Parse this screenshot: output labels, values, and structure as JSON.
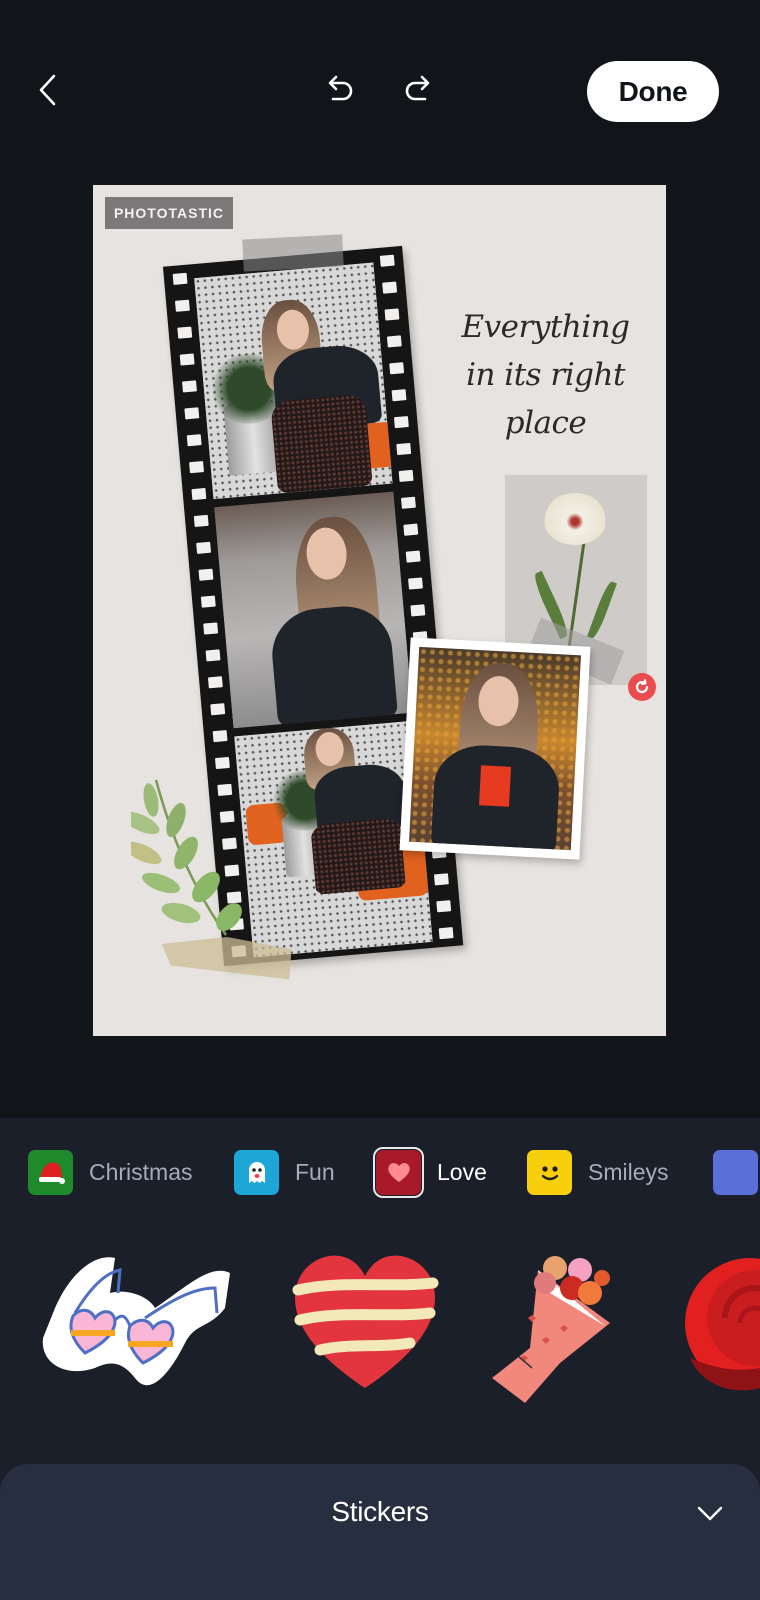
{
  "topbar": {
    "back_icon": "chevron-left-icon",
    "undo_icon": "undo-icon",
    "redo_icon": "redo-icon",
    "done_label": "Done"
  },
  "canvas": {
    "brand_tag": "PHOTOTASTIC",
    "quote_lines": [
      "Everything",
      "in its right",
      "place"
    ],
    "rotate_icon": "rotate-icon"
  },
  "categories": [
    {
      "label": "Christmas",
      "icon": "santa-hat-icon",
      "color": "#1f8a2c",
      "active": false
    },
    {
      "label": "Fun",
      "icon": "ghost-icon",
      "color": "#1fa6d8",
      "active": false
    },
    {
      "label": "Love",
      "icon": "heart-icon",
      "color": "#a8192a",
      "active": true
    },
    {
      "label": "Smileys",
      "icon": "smiley-icon",
      "color": "#f7cf0d",
      "active": false
    },
    {
      "label": "",
      "icon": "category-icon",
      "color": "#5b6fd9",
      "active": false
    }
  ],
  "stickers": [
    {
      "name": "heart-glasses-sticker"
    },
    {
      "name": "striped-heart-sticker"
    },
    {
      "name": "flower-bouquet-sticker"
    },
    {
      "name": "red-rose-sticker"
    }
  ],
  "sheet": {
    "title": "Stickers",
    "collapse_icon": "chevron-down-icon"
  },
  "colors": {
    "app_bg": "#111419",
    "panel_bg": "#1b1f2a",
    "sheet_bg": "#262e40",
    "accent_red": "#ea4b4e"
  }
}
